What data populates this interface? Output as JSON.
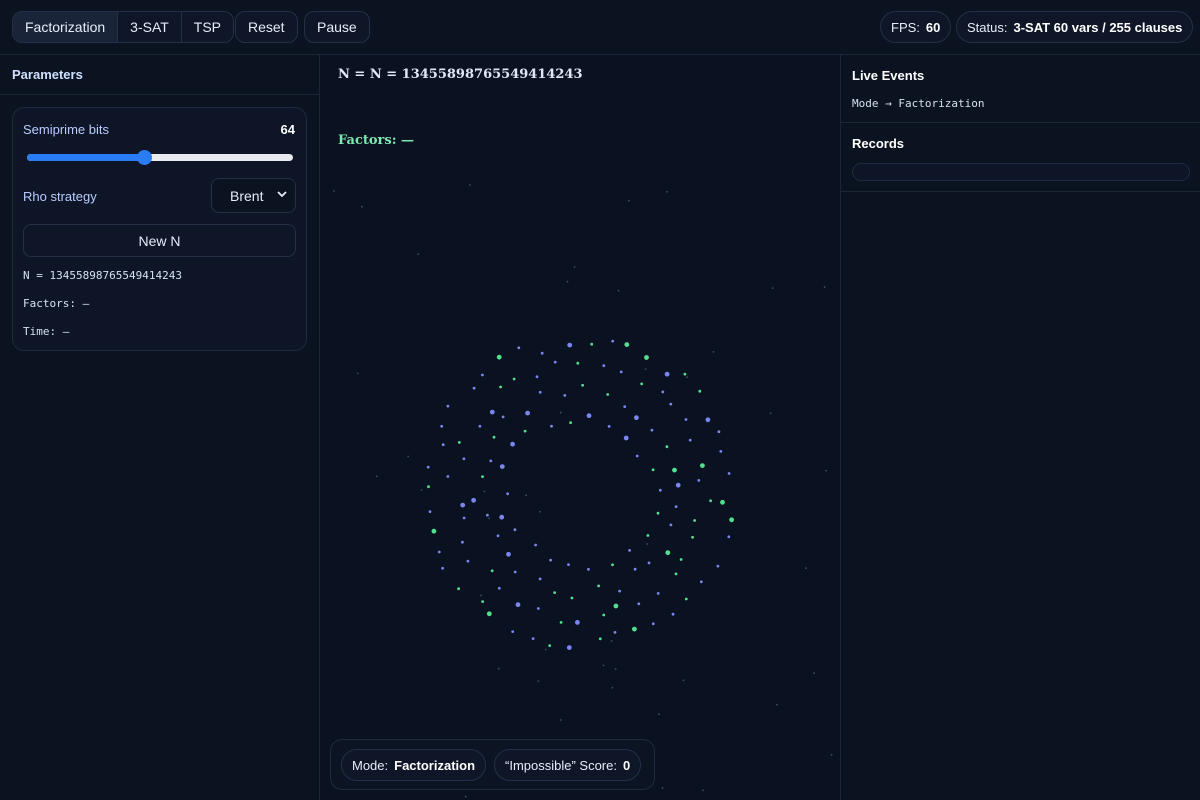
{
  "toolbar": {
    "modes": [
      "Factorization",
      "3-SAT",
      "TSP"
    ],
    "active_mode": "Factorization",
    "reset_label": "Reset",
    "pause_label": "Pause",
    "fps_label": "FPS:",
    "fps_value": "60",
    "status_label": "Status:",
    "status_value": "3-SAT 60 vars / 255 clauses"
  },
  "params": {
    "title": "Parameters",
    "bits_label": "Semiprime bits",
    "bits_value": "64",
    "bits_slider_fraction": 0.44,
    "rho_label": "Rho strategy",
    "rho_value": "Brent",
    "new_n_label": "New N",
    "n_line": "N = 13455898765549414243",
    "factors_line": "Factors: —",
    "time_line": "Time: —"
  },
  "canvas": {
    "n_title": "N = N = 13455898765549414243",
    "factors_title": "Factors: —",
    "mode_label": "Mode:",
    "mode_value": "Factorization",
    "score_label": "“Impossible” Score:",
    "score_value": "0",
    "colors": {
      "purple": "#7a86f0",
      "green": "#52e08e",
      "star": "#3a4f6e"
    }
  },
  "sidebar": {
    "live_events_title": "Live Events",
    "events": [
      "Mode → Factorization"
    ],
    "records_title": "Records"
  }
}
